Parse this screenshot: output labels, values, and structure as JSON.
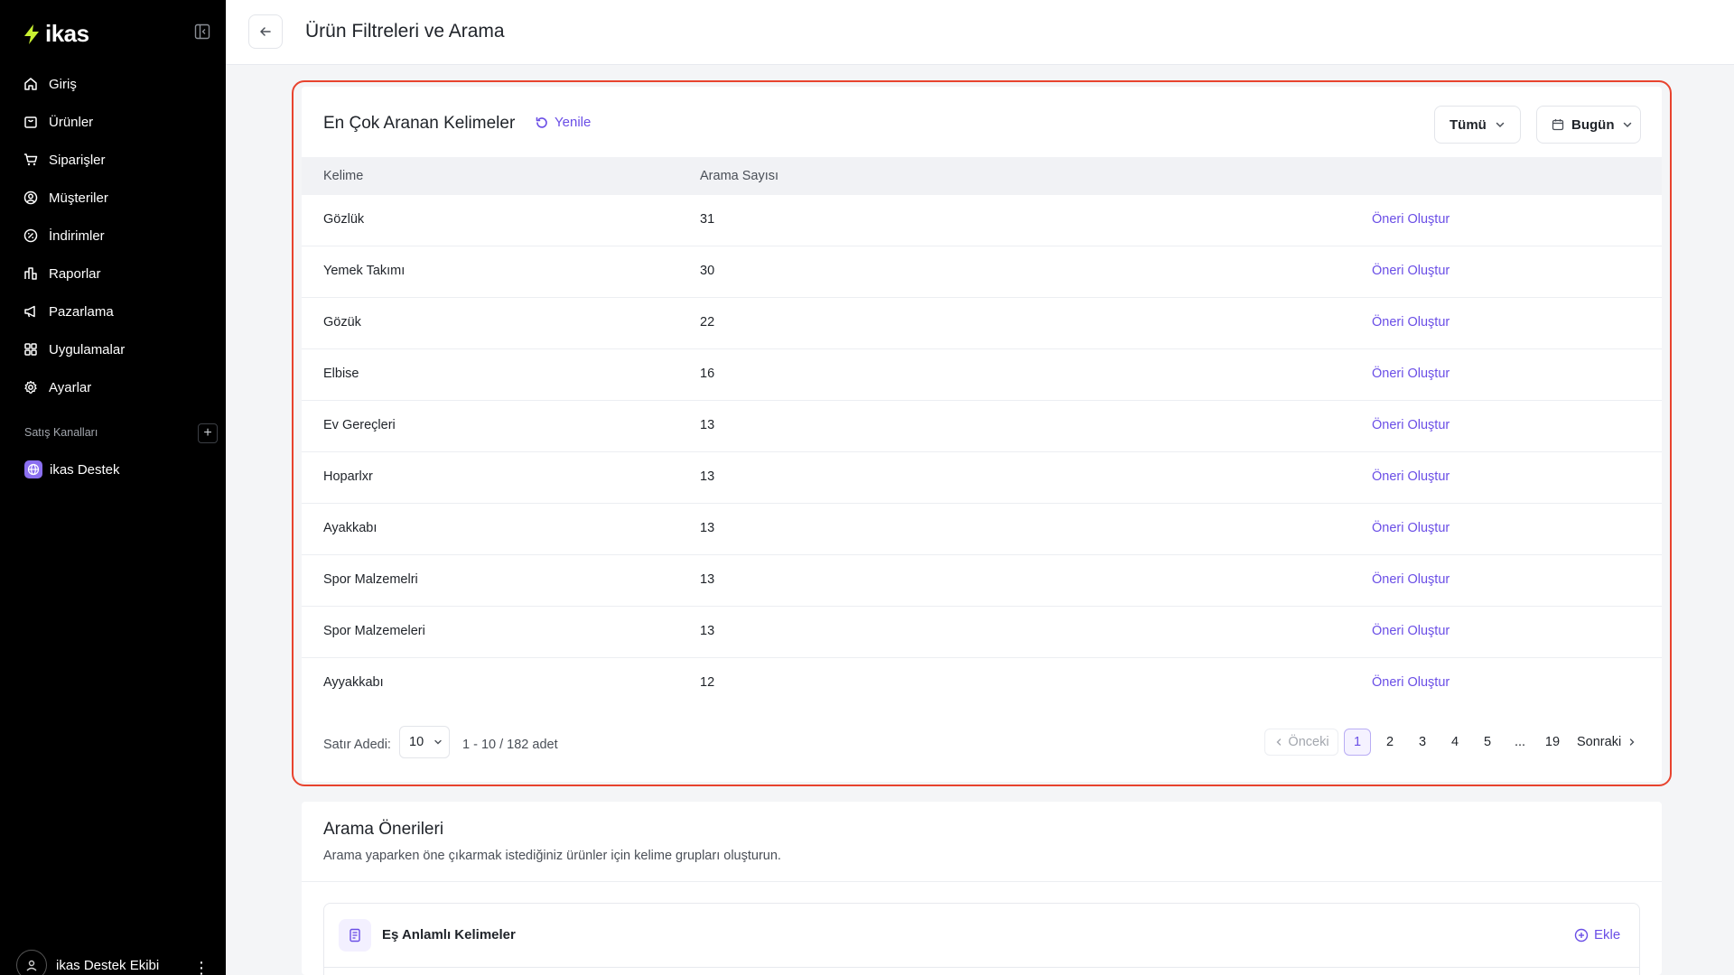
{
  "brand": {
    "name": "ikas",
    "accent": "#c8f031"
  },
  "sidebar": {
    "items": [
      {
        "label": "Giriş",
        "icon": "home-icon"
      },
      {
        "label": "Ürünler",
        "icon": "box-icon"
      },
      {
        "label": "Siparişler",
        "icon": "cart-icon"
      },
      {
        "label": "Müşteriler",
        "icon": "user-circle-icon"
      },
      {
        "label": "İndirimler",
        "icon": "discount-icon"
      },
      {
        "label": "Raporlar",
        "icon": "report-icon"
      },
      {
        "label": "Pazarlama",
        "icon": "megaphone-icon"
      },
      {
        "label": "Uygulamalar",
        "icon": "apps-icon"
      },
      {
        "label": "Ayarlar",
        "icon": "gear-icon"
      }
    ],
    "section_label": "Satış Kanalları",
    "channel": "ikas Destek",
    "user_name": "ikas Destek Ekibi"
  },
  "header": {
    "title": "Ürün Filtreleri ve Arama"
  },
  "top_searches": {
    "title": "En Çok Aranan Kelimeler",
    "refresh_label": "Yenile",
    "filter_label": "Tümü",
    "date_label": "Bugün",
    "columns": [
      "Kelime",
      "Arama Sayısı"
    ],
    "action_label": "Öneri Oluştur",
    "rows": [
      {
        "word": "Gözlük",
        "count": "31"
      },
      {
        "word": "Yemek Takımı",
        "count": "30"
      },
      {
        "word": "Gözük",
        "count": "22"
      },
      {
        "word": "Elbise",
        "count": "16"
      },
      {
        "word": "Ev Gereçleri",
        "count": "13"
      },
      {
        "word": "Hoparlxr",
        "count": "13"
      },
      {
        "word": "Ayakkabı",
        "count": "13"
      },
      {
        "word": "Spor Malzemelri",
        "count": "13"
      },
      {
        "word": "Spor Malzemeleri",
        "count": "13"
      },
      {
        "word": "Ayyakkabı",
        "count": "12"
      }
    ],
    "footer": {
      "rows_label": "Satır Adedi:",
      "rows_value": "10",
      "range": "1 - 10 / 182 adet",
      "prev": "Önceki",
      "pages": [
        "1",
        "2",
        "3",
        "4",
        "5",
        "...",
        "19"
      ],
      "next": "Sonraki"
    }
  },
  "suggestions": {
    "title": "Arama Önerileri",
    "subtitle": "Arama yaparken öne çıkarmak istediğiniz ürünler için kelime grupları oluşturun.",
    "synonyms_label": "Eş Anlamlı Kelimeler",
    "add_label": "Ekle"
  }
}
